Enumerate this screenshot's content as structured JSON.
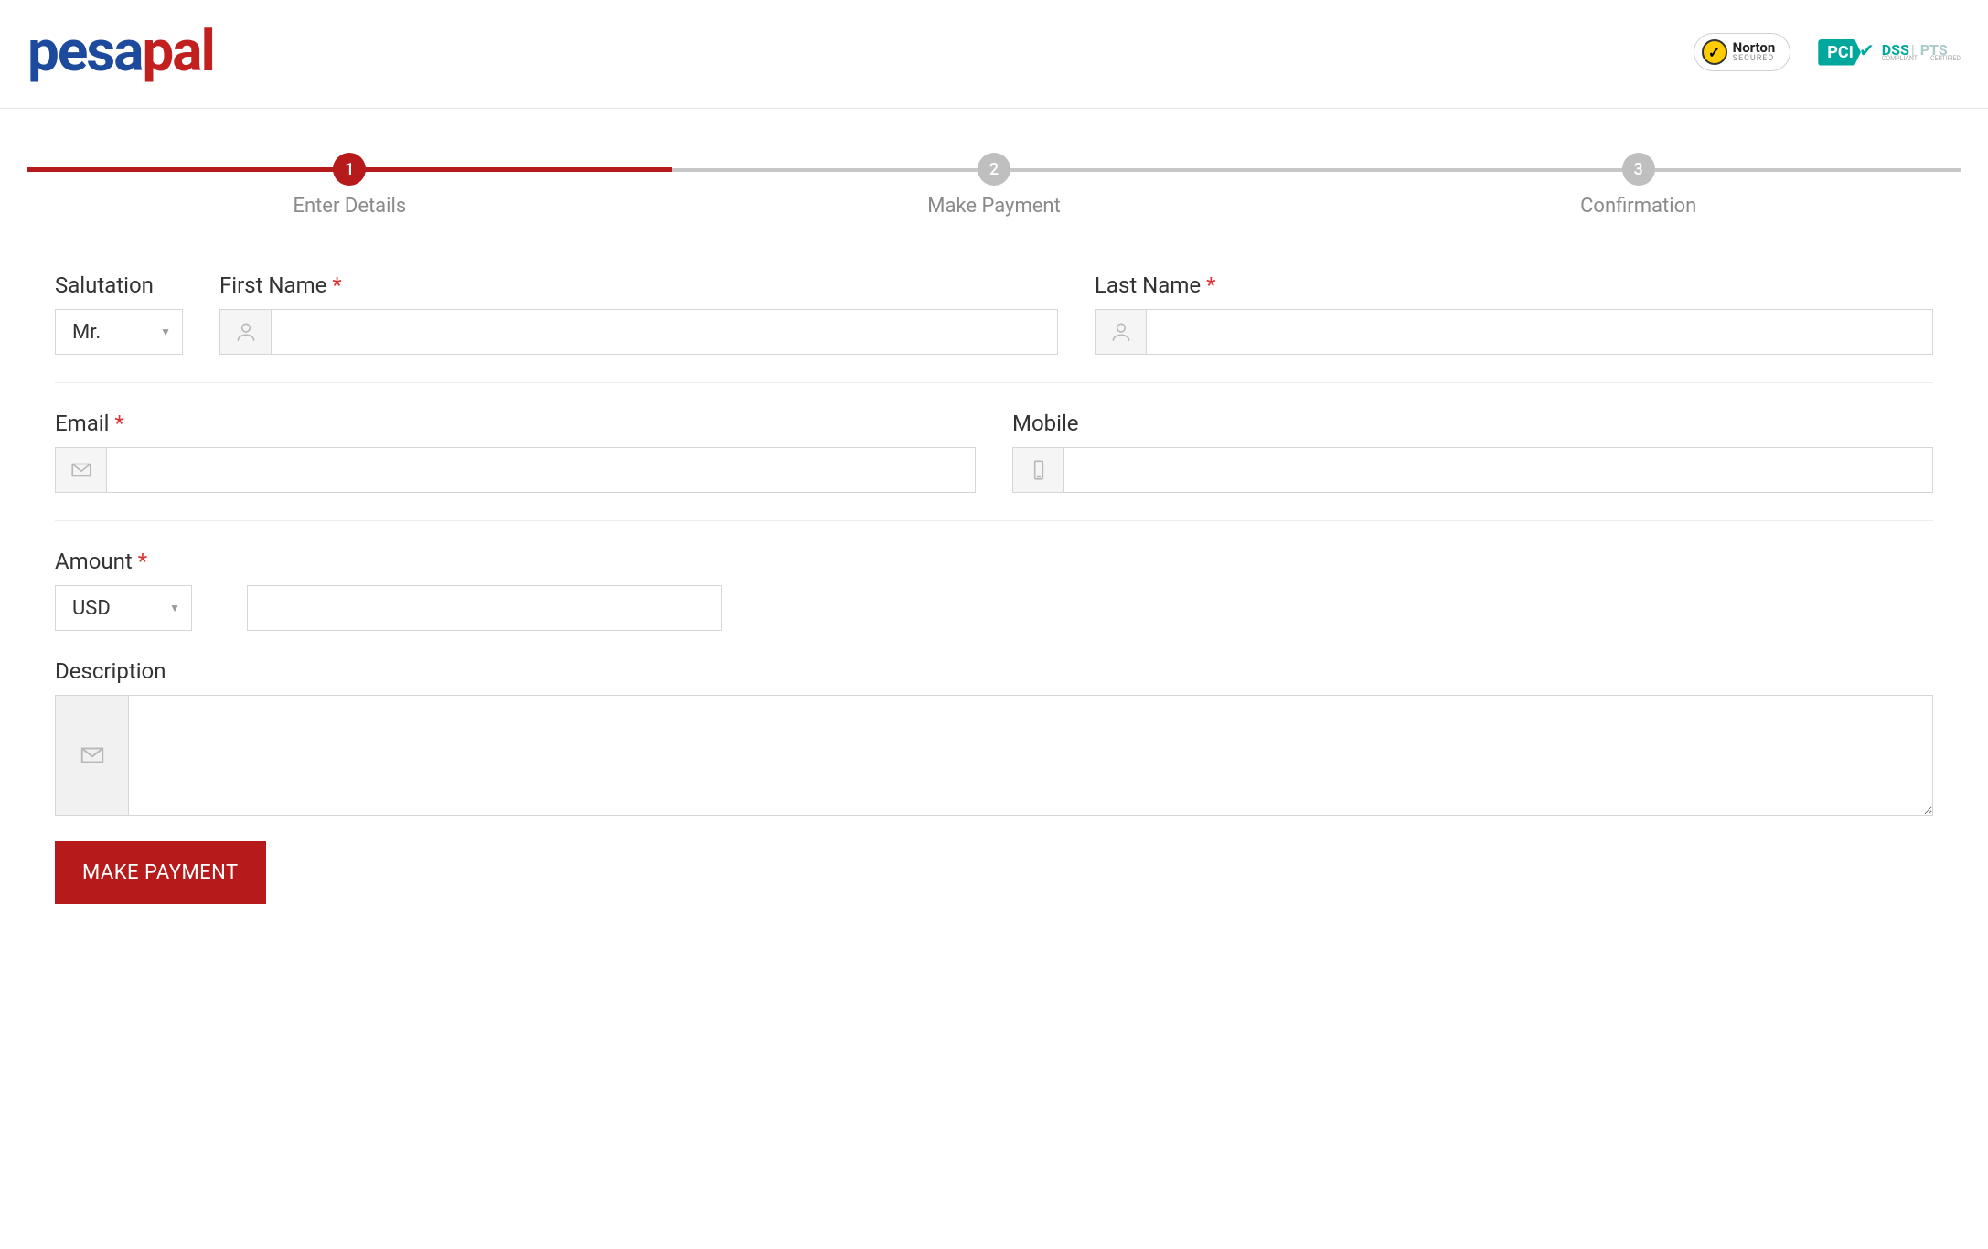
{
  "brand": {
    "part1": "pesa",
    "part2": "pal"
  },
  "badges": {
    "norton": {
      "line1": "Norton",
      "line2": "SECURED"
    },
    "pci": {
      "main": "PCI",
      "dss": "DSS",
      "pts": "PTS",
      "sub1": "COMPLIANT",
      "sub2": "CERTIFIED"
    }
  },
  "stepper": {
    "steps": [
      {
        "num": "1",
        "label": "Enter Details"
      },
      {
        "num": "2",
        "label": "Make Payment"
      },
      {
        "num": "3",
        "label": "Confirmation"
      }
    ]
  },
  "form": {
    "salutation": {
      "label": "Salutation",
      "value": "Mr."
    },
    "first_name": {
      "label": "First Name",
      "value": ""
    },
    "last_name": {
      "label": "Last Name",
      "value": ""
    },
    "email": {
      "label": "Email",
      "value": ""
    },
    "mobile": {
      "label": "Mobile",
      "value": ""
    },
    "amount": {
      "label": "Amount",
      "currency": "USD",
      "value": ""
    },
    "description": {
      "label": "Description",
      "value": ""
    },
    "submit_label": "MAKE PAYMENT",
    "required_marker": "*"
  }
}
